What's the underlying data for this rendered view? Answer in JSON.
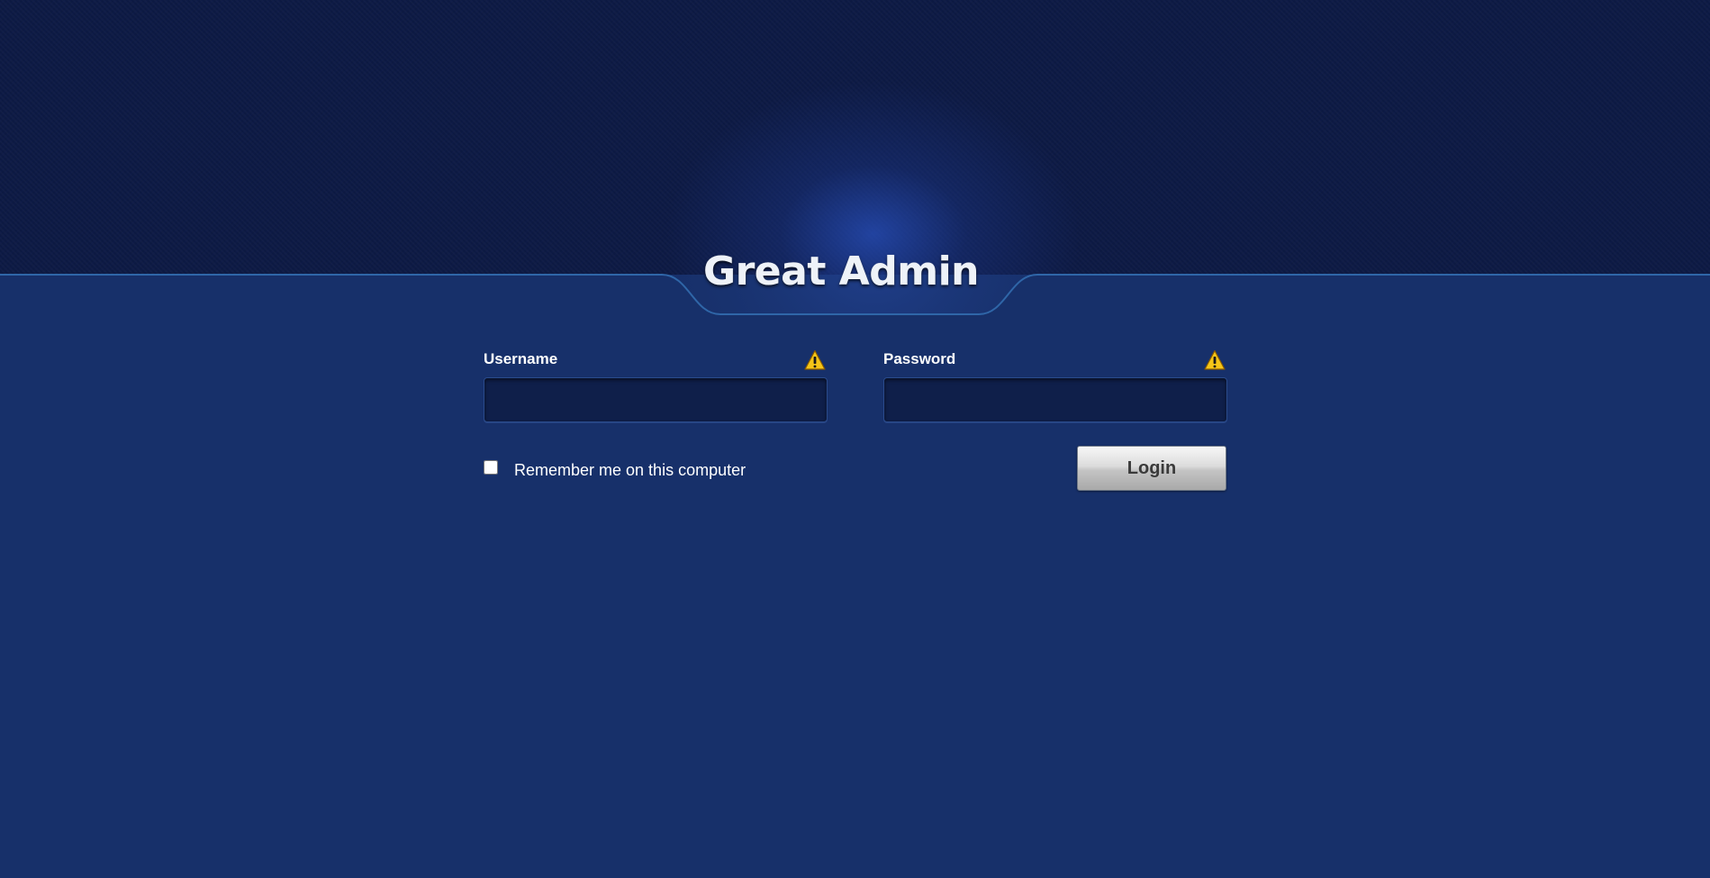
{
  "header": {
    "title": "Great Admin"
  },
  "login_form": {
    "username": {
      "label": "Username",
      "value": "",
      "icon": "warning-icon"
    },
    "password": {
      "label": "Password",
      "value": "",
      "icon": "warning-icon"
    },
    "remember": {
      "label": "Remember me on this computer",
      "checked": false
    },
    "submit_label": "Login"
  },
  "colors": {
    "page_background": "#17306a",
    "header_background": "#0d1a45",
    "input_background": "#0f1f4a",
    "warning_yellow": "#f5c518"
  }
}
